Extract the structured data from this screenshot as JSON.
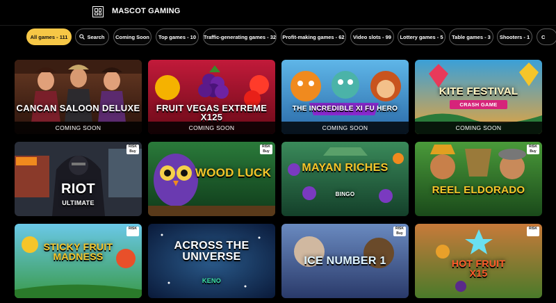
{
  "header": {
    "brand": "MASCOT GAMING"
  },
  "filters": [
    {
      "label": "All games - 111",
      "active": true
    },
    {
      "label": "Search",
      "icon": "search-icon"
    },
    {
      "label": "Coming Soon"
    },
    {
      "label": "Top games - 10"
    },
    {
      "label": "Traffic-generating games - 32"
    },
    {
      "label": "Profit-making games - 62"
    },
    {
      "label": "Video slots - 99"
    },
    {
      "label": "Lottery games - 5"
    },
    {
      "label": "Table games - 3"
    },
    {
      "label": "Shooters - 1"
    },
    {
      "label": "C"
    }
  ],
  "games": [
    {
      "title": "CANCAN SALOON DELUXE",
      "status": "COMING SOON"
    },
    {
      "title": "FRUIT VEGAS EXTREME X125",
      "status": "COMING SOON"
    },
    {
      "title": "THE INCREDIBLE XI FU HERO",
      "status": "COMING SOON"
    },
    {
      "title": "KITE FESTIVAL",
      "subtitle": "CRASH GAME",
      "status": "COMING SOON"
    },
    {
      "title": "RIOT",
      "subtitle": "ULTIMATE",
      "badge": "RISK Buy"
    },
    {
      "title": "WOOD LUCK",
      "badge": "RISK Buy"
    },
    {
      "title": "MAYAN RICHES",
      "subtitle": "BINGO",
      "badge": "RISK Buy"
    },
    {
      "title": "REEL ELDORADO",
      "badge": "RISK Buy"
    },
    {
      "title": "STICKY FRUIT MADNESS",
      "badge": "RISK"
    },
    {
      "title": "ACROSS THE UNIVERSE",
      "subtitle": "KENO"
    },
    {
      "title": "ICE NUMBER 1",
      "badge": "RISK Buy"
    },
    {
      "title": "HOT FRUIT X15",
      "badge": "RISK"
    }
  ],
  "colors": {
    "accent": "#f6c746",
    "background": "#000000"
  }
}
